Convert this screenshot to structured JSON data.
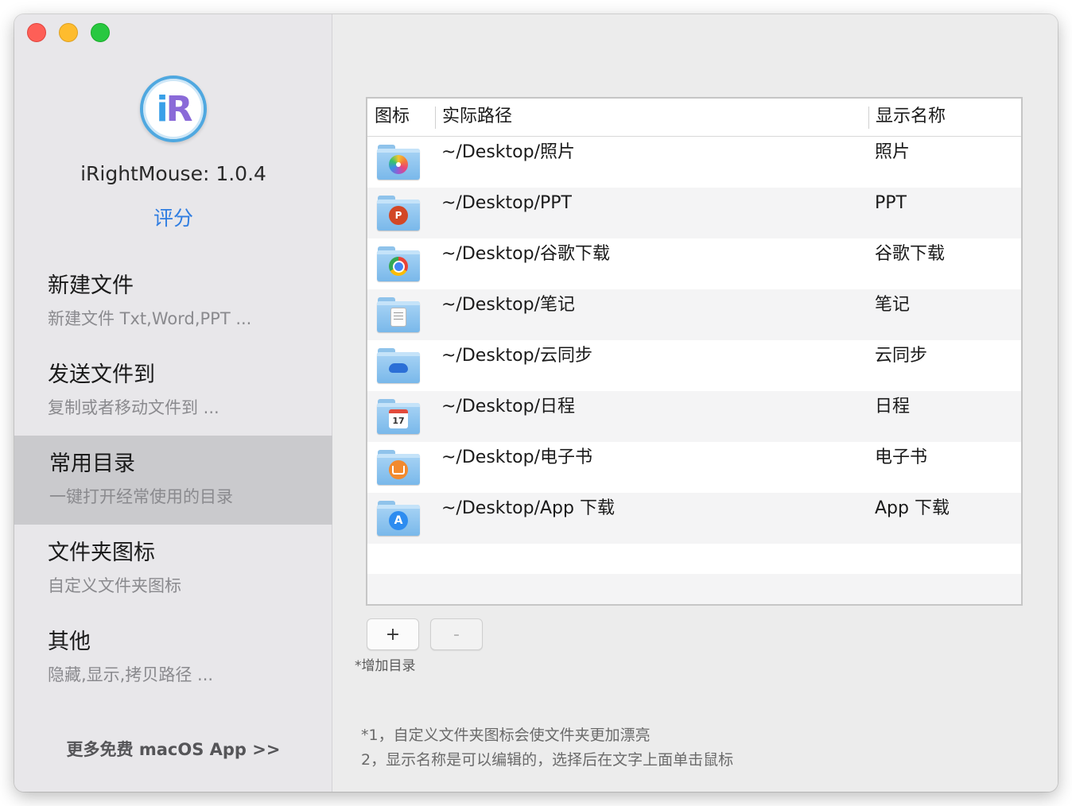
{
  "window": {
    "traffic_lights": {
      "close": "#fe5f57",
      "minimize": "#febc2e",
      "maximize": "#28c840"
    }
  },
  "sidebar": {
    "app_version": "iRightMouse: 1.0.4",
    "rate_label": "评分",
    "nav_items": [
      {
        "title": "新建文件",
        "subtitle": "新建文件 Txt,Word,PPT ...",
        "active": false
      },
      {
        "title": "发送文件到",
        "subtitle": "复制或者移动文件到 ...",
        "active": false
      },
      {
        "title": "常用目录",
        "subtitle": "一键打开经常使用的目录",
        "active": true
      },
      {
        "title": "文件夹图标",
        "subtitle": "自定义文件夹图标",
        "active": false
      },
      {
        "title": "其他",
        "subtitle": "隐藏,显示,拷贝路径 ...",
        "active": false
      }
    ],
    "more_apps_label": "更多免费 macOS App >>",
    "accent_color": "#2f7de1"
  },
  "table": {
    "headers": {
      "icon": "图标",
      "path": "实际路径",
      "name": "显示名称"
    },
    "rows": [
      {
        "icon": "photos-folder-icon",
        "path": "~/Desktop/照片",
        "name": "照片"
      },
      {
        "icon": "powerpoint-folder-icon",
        "path": "~/Desktop/PPT",
        "name": "PPT"
      },
      {
        "icon": "chrome-folder-icon",
        "path": "~/Desktop/谷歌下载",
        "name": "谷歌下载"
      },
      {
        "icon": "notes-folder-icon",
        "path": "~/Desktop/笔记",
        "name": "笔记"
      },
      {
        "icon": "onedrive-folder-icon",
        "path": "~/Desktop/云同步",
        "name": "云同步"
      },
      {
        "icon": "calendar-folder-icon",
        "path": "~/Desktop/日程",
        "name": "日程",
        "badge_text": "17"
      },
      {
        "icon": "books-folder-icon",
        "path": "~/Desktop/电子书",
        "name": "电子书"
      },
      {
        "icon": "appstore-folder-icon",
        "path": "~/Desktop/App 下载",
        "name": "App 下载"
      }
    ]
  },
  "controls": {
    "add_label": "+",
    "remove_label": "-",
    "add_caption": "*增加目录"
  },
  "notes": {
    "line1": "*1，自定义文件夹图标会使文件夹更加漂亮",
    "line2": " 2，显示名称是可以编辑的，选择后在文字上面单击鼠标"
  }
}
